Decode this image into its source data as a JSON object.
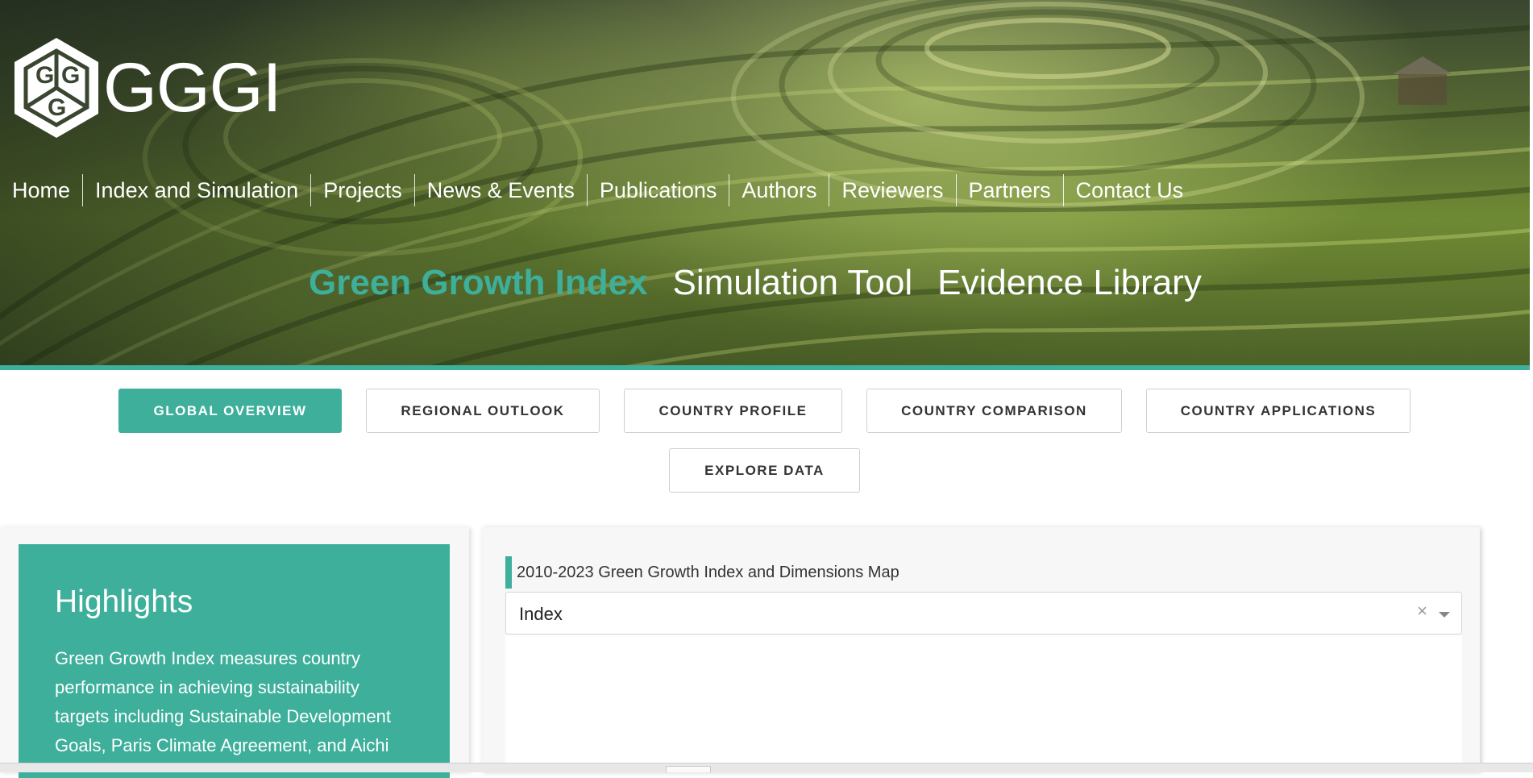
{
  "brand": {
    "logo_text": "GGGI",
    "accent": "#3daf9a"
  },
  "mainnav": [
    "Home",
    "Index and Simulation",
    "Projects",
    "News & Events",
    "Publications",
    "Authors",
    "Reviewers",
    "Partners",
    "Contact Us"
  ],
  "tools": [
    "Green Growth Index",
    "Simulation Tool",
    "Evidence Library"
  ],
  "tabs": [
    "GLOBAL OVERVIEW",
    "REGIONAL OUTLOOK",
    "COUNTRY PROFILE",
    "COUNTRY COMPARISON",
    "COUNTRY APPLICATIONS",
    "EXPLORE DATA"
  ],
  "highlights": {
    "title": "Highlights",
    "body": "Green Growth Index measures country performance in achieving sustainability targets including Sustainable Development Goals, Paris Climate Agreement, and Aichi"
  },
  "map_panel": {
    "title": "2010-2023 Green Growth Index and Dimensions Map",
    "select_value": "Index",
    "clear_glyph": "×"
  }
}
